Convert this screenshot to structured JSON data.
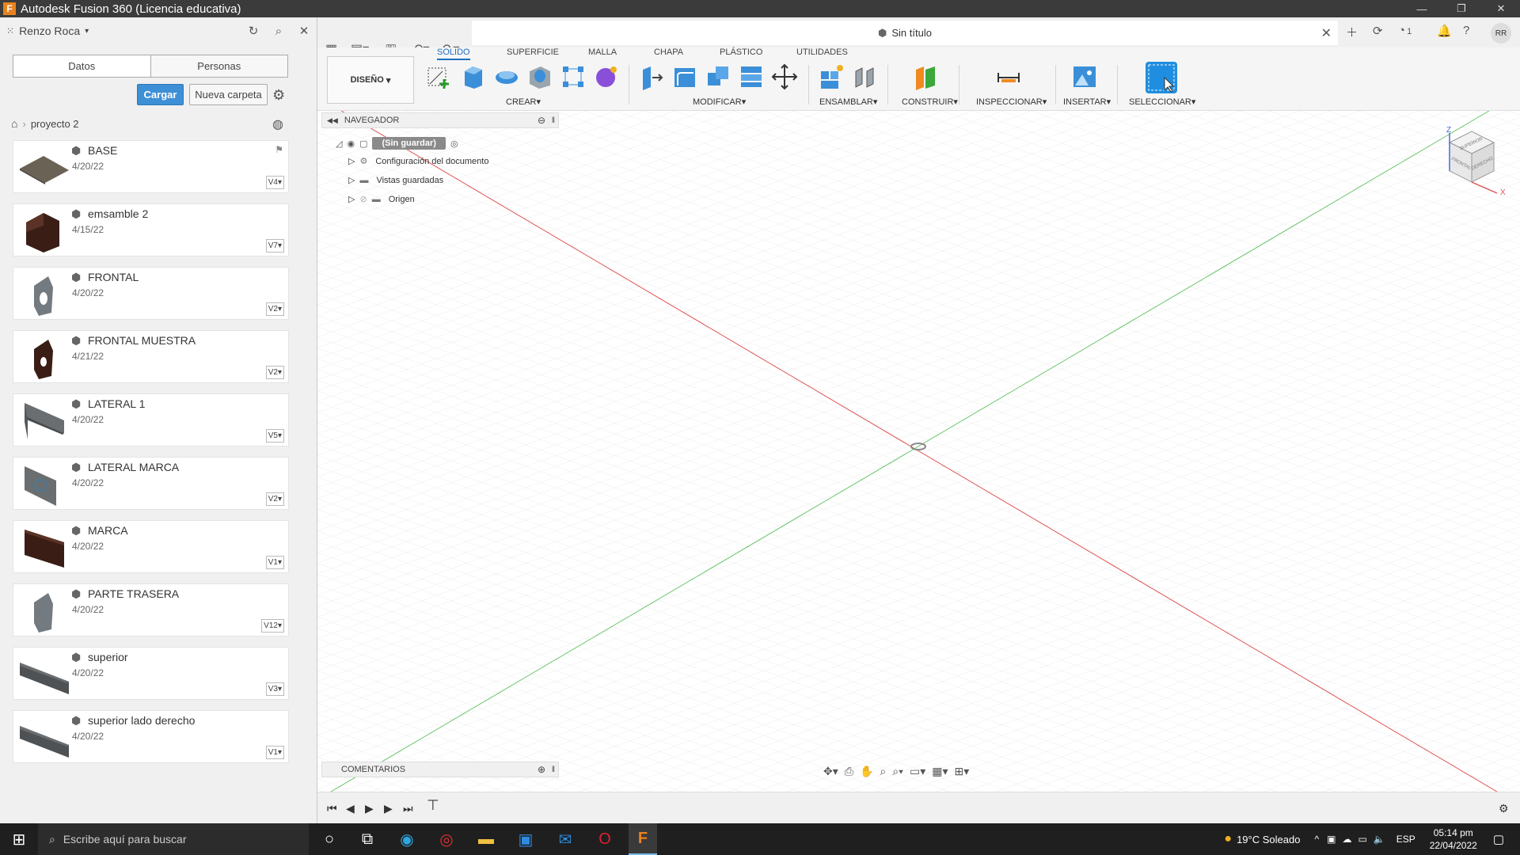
{
  "window": {
    "title": "Autodesk Fusion 360 (Licencia educativa)",
    "logo": "F"
  },
  "left_panel": {
    "user": "Renzo Roca",
    "tabs": [
      "Datos",
      "Personas"
    ],
    "upload_label": "Cargar",
    "new_folder_label": "Nueva carpeta",
    "breadcrumb_project": "proyecto 2",
    "files": [
      {
        "name": "BASE",
        "date": "4/20/22",
        "version": "V4"
      },
      {
        "name": "emsamble 2",
        "date": "4/15/22",
        "version": "V7"
      },
      {
        "name": "FRONTAL",
        "date": "4/20/22",
        "version": "V2"
      },
      {
        "name": "FRONTAL MUESTRA",
        "date": "4/21/22",
        "version": "V2"
      },
      {
        "name": "LATERAL 1",
        "date": "4/20/22",
        "version": "V5"
      },
      {
        "name": "LATERAL MARCA",
        "date": "4/20/22",
        "version": "V2"
      },
      {
        "name": "MARCA",
        "date": "4/20/22",
        "version": "V1"
      },
      {
        "name": "PARTE TRASERA",
        "date": "4/20/22",
        "version": "V12"
      },
      {
        "name": "superior",
        "date": "4/20/22",
        "version": "V3"
      },
      {
        "name": "superior lado derecho",
        "date": "4/20/22",
        "version": "V1"
      }
    ]
  },
  "document": {
    "title": "Sin título",
    "notifications": "1",
    "avatar": "RR"
  },
  "ribbon": {
    "workspace": "DISEÑO",
    "tabs": [
      "SOLIDO",
      "SUPERFICIE",
      "MALLA",
      "CHAPA",
      "PLÁSTICO",
      "UTILIDADES"
    ],
    "groups": [
      "CREAR",
      "MODIFICAR",
      "ENSAMBLAR",
      "CONSTRUIR",
      "INSPECCIONAR",
      "INSERTAR",
      "SELECCIONAR"
    ]
  },
  "navigator": {
    "title": "NAVEGADOR",
    "root": "(Sin guardar)",
    "items": [
      "Configuración del documento",
      "Vistas guardadas",
      "Origen"
    ]
  },
  "comments": {
    "title": "COMENTARIOS"
  },
  "viewcube": {
    "top": "SUPERIOR",
    "front": "FRONTAL",
    "right": "DERECHO",
    "axis_z": "Z",
    "axis_x": "X"
  },
  "taskbar": {
    "search_placeholder": "Escribe aquí para buscar",
    "weather": "19°C  Soleado",
    "language": "ESP",
    "time": "05:14 pm",
    "date": "22/04/2022"
  },
  "colors": {
    "accent": "#1f6fbf",
    "upload": "#3d8fd6",
    "axis_x": "#e05252",
    "axis_y": "#6cc66c"
  }
}
